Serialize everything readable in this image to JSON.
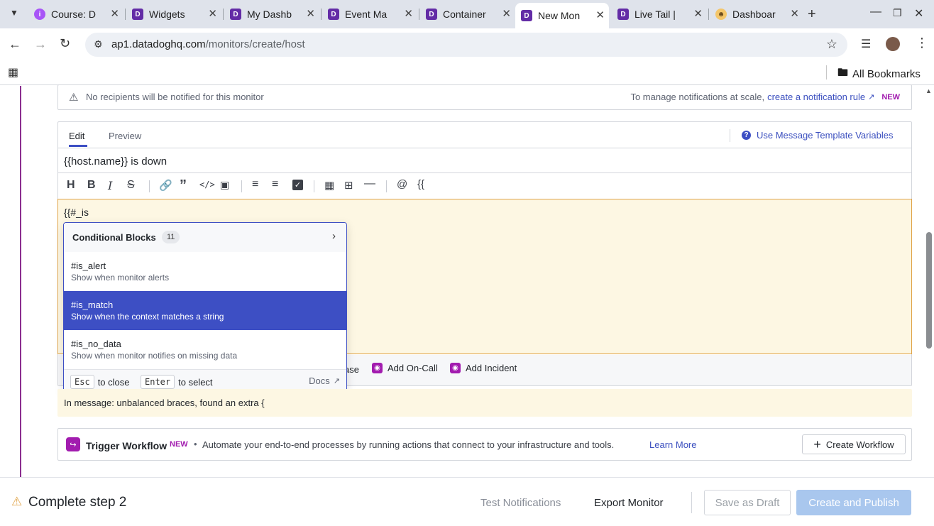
{
  "browser": {
    "tabs": [
      {
        "title": "Course: D",
        "icon": "course-icon"
      },
      {
        "title": "Widgets",
        "icon": "datadog-icon"
      },
      {
        "title": "My Dashb",
        "icon": "datadog-icon"
      },
      {
        "title": "Event Ma",
        "icon": "datadog-icon"
      },
      {
        "title": "Container",
        "icon": "datadog-icon"
      },
      {
        "title": "New Mon",
        "icon": "datadog-icon"
      },
      {
        "title": "Live Tail |",
        "icon": "datadog-icon"
      },
      {
        "title": "Dashboar",
        "icon": "dashboard-icon"
      }
    ],
    "url": "ap1.datadoghq.com/monitors/create/host",
    "url_domain": "ap1.datadoghq.com",
    "url_path": "/monitors/create/host",
    "bookmarks_label": "All Bookmarks"
  },
  "notice": {
    "text": "No recipients will be notified for this monitor",
    "manage_text": "To manage notifications at scale,",
    "rule_link": "create a notification rule",
    "new_badge": "NEW"
  },
  "editor": {
    "tabs": [
      "Edit",
      "Preview"
    ],
    "template_link": "Use Message Template Variables",
    "subject": "{{host.name}} is down",
    "body": "{{#_is"
  },
  "autocomplete": {
    "header": "Conditional Blocks",
    "count": "11",
    "items": [
      {
        "name": "#is_alert",
        "desc": "Show when monitor alerts"
      },
      {
        "name": "#is_match",
        "desc": "Show when the context matches a string"
      },
      {
        "name": "#is_no_data",
        "desc": "Show when monitor notifies on missing data"
      }
    ],
    "footer": {
      "esc": "Esc",
      "esc_label": "to close",
      "enter": "Enter",
      "enter_label": "to select",
      "docs": "Docs"
    }
  },
  "actions": {
    "partial": "ase",
    "oncall": "Add On-Call",
    "incident": "Add Incident"
  },
  "warning": "In message: unbalanced braces, found an extra {",
  "workflow": {
    "title": "Trigger Workflow",
    "new_badge": "NEW",
    "desc": "Automate your end-to-end processes by running actions that connect to your infrastructure and tools.",
    "learn_more": "Learn More",
    "create_button": "Create Workflow"
  },
  "footer": {
    "step": "Complete step 2",
    "test": "Test Notifications",
    "export": "Export Monitor",
    "draft": "Save as Draft",
    "publish": "Create and Publish"
  },
  "colors": {
    "accent": "#3d4fc4",
    "datadog_purple": "#632ca6",
    "warning_bg": "#fdf7e3",
    "publish_bg": "#a9c7ee"
  }
}
